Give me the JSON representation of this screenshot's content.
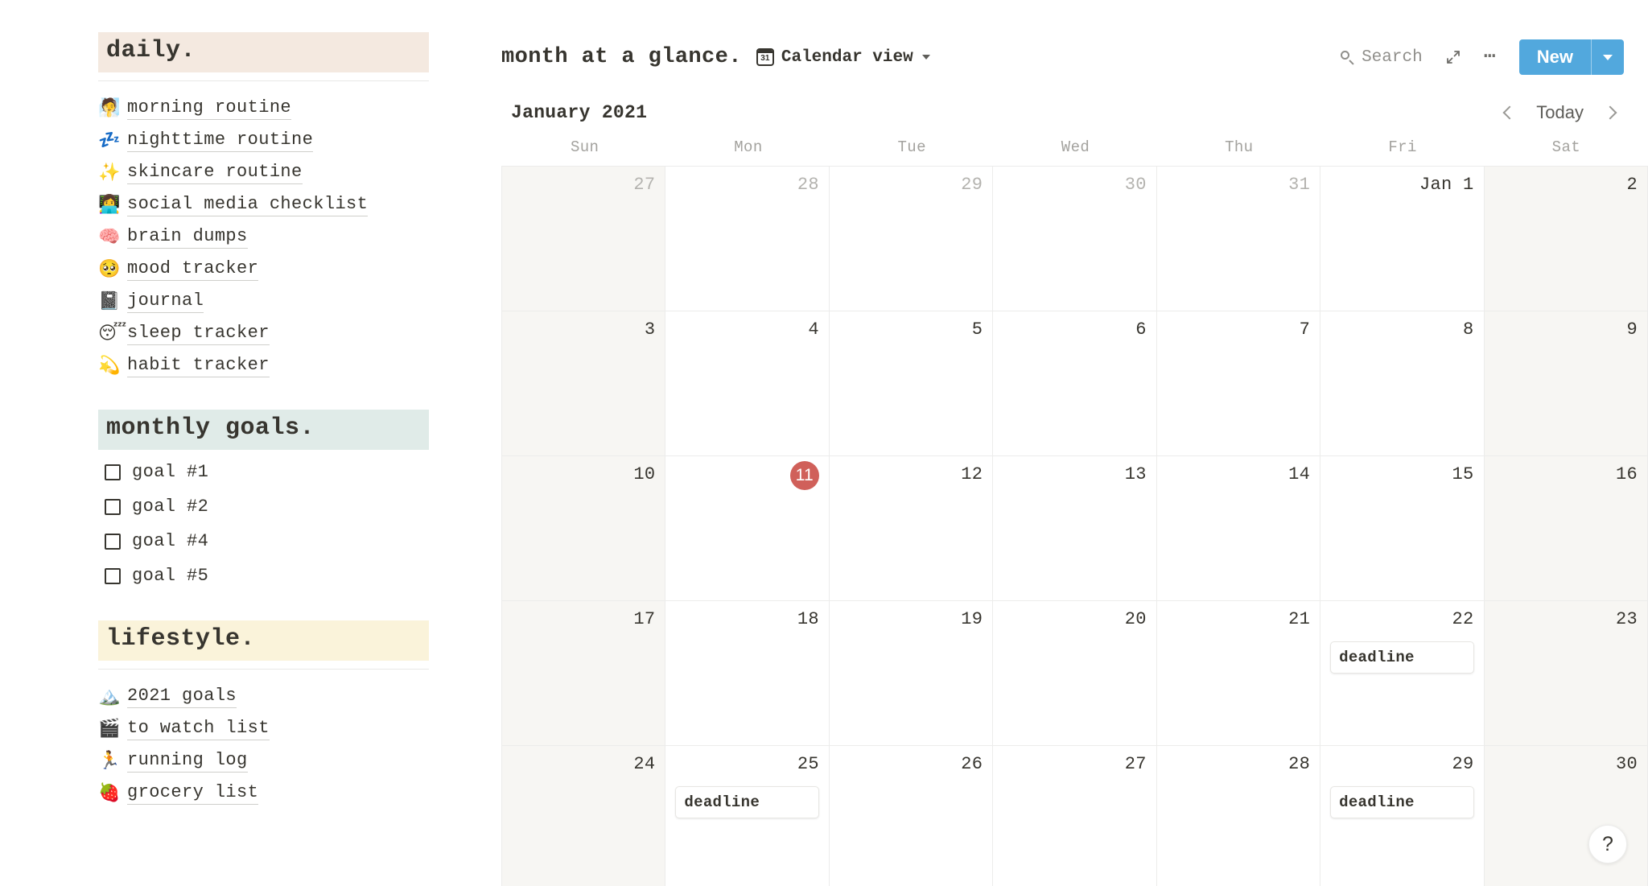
{
  "sidebar": {
    "sections": [
      {
        "title": "daily.",
        "highlight": "#f4e9e0",
        "kind": "links",
        "items": [
          {
            "emoji": "🧖",
            "icon_name": "person-steamy-room-emoji",
            "label": "morning routine"
          },
          {
            "emoji": "💤",
            "icon_name": "zzz-emoji",
            "label": "nighttime routine"
          },
          {
            "emoji": "✨",
            "icon_name": "sparkles-emoji",
            "label": "skincare routine"
          },
          {
            "emoji": "👩‍💻",
            "icon_name": "woman-technologist-emoji",
            "label": "social media checklist"
          },
          {
            "emoji": "🧠",
            "icon_name": "brain-emoji",
            "label": "brain dumps"
          },
          {
            "emoji": "🥺",
            "icon_name": "pleading-face-emoji",
            "label": "mood tracker"
          },
          {
            "emoji": "📓",
            "icon_name": "notebook-emoji",
            "label": "journal"
          },
          {
            "emoji": "😴",
            "icon_name": "sleeping-face-emoji",
            "label": "sleep tracker"
          },
          {
            "emoji": "💫",
            "icon_name": "dizzy-star-emoji",
            "label": "habit tracker"
          }
        ]
      },
      {
        "title": "monthly goals.",
        "highlight": "#e0ebe8",
        "kind": "todos",
        "items": [
          {
            "label": "goal #1",
            "checked": false
          },
          {
            "label": "goal #2",
            "checked": false
          },
          {
            "label": "goal #4",
            "checked": false
          },
          {
            "label": "goal #5",
            "checked": false
          }
        ]
      },
      {
        "title": "lifestyle.",
        "highlight": "#faf3da",
        "kind": "links",
        "items": [
          {
            "emoji": "🏔️",
            "icon_name": "mountain-emoji",
            "label": "2021 goals"
          },
          {
            "emoji": "🎬",
            "icon_name": "clapper-board-emoji",
            "label": "to watch list"
          },
          {
            "emoji": "🏃",
            "icon_name": "running-person-emoji",
            "label": "running log"
          },
          {
            "emoji": "🍓",
            "icon_name": "strawberry-emoji",
            "label": "grocery list"
          }
        ]
      }
    ]
  },
  "main": {
    "database_title": "month at a glance.",
    "view": {
      "label": "Calendar view",
      "icon": "calendar-31-icon",
      "icon_text": "31"
    },
    "toolbar": {
      "search_label": "Search",
      "expand_icon": "expand-diagonal-icon",
      "more_icon": "ellipsis-icon",
      "new_label": "New",
      "new_caret_icon": "chevron-down-icon",
      "new_color": "#52a8dd"
    },
    "month_label": "January 2021",
    "today_label": "Today",
    "prev_icon": "chevron-left-icon",
    "next_icon": "chevron-right-icon",
    "help_label": "?",
    "weekdays": [
      "Sun",
      "Mon",
      "Tue",
      "Wed",
      "Thu",
      "Fri",
      "Sat"
    ],
    "today_marker_color": "#d0605a",
    "weeks": [
      [
        {
          "day": "27",
          "muted": true,
          "weekend": true,
          "today": false,
          "events": []
        },
        {
          "day": "28",
          "muted": true,
          "weekend": false,
          "today": false,
          "events": []
        },
        {
          "day": "29",
          "muted": true,
          "weekend": false,
          "today": false,
          "events": []
        },
        {
          "day": "30",
          "muted": true,
          "weekend": false,
          "today": false,
          "events": []
        },
        {
          "day": "31",
          "muted": true,
          "weekend": false,
          "today": false,
          "events": []
        },
        {
          "day": "Jan 1",
          "muted": false,
          "weekend": false,
          "today": false,
          "events": []
        },
        {
          "day": "2",
          "muted": false,
          "weekend": true,
          "today": false,
          "events": []
        }
      ],
      [
        {
          "day": "3",
          "muted": false,
          "weekend": true,
          "today": false,
          "events": []
        },
        {
          "day": "4",
          "muted": false,
          "weekend": false,
          "today": false,
          "events": []
        },
        {
          "day": "5",
          "muted": false,
          "weekend": false,
          "today": false,
          "events": []
        },
        {
          "day": "6",
          "muted": false,
          "weekend": false,
          "today": false,
          "events": []
        },
        {
          "day": "7",
          "muted": false,
          "weekend": false,
          "today": false,
          "events": []
        },
        {
          "day": "8",
          "muted": false,
          "weekend": false,
          "today": false,
          "events": []
        },
        {
          "day": "9",
          "muted": false,
          "weekend": true,
          "today": false,
          "events": []
        }
      ],
      [
        {
          "day": "10",
          "muted": false,
          "weekend": true,
          "today": false,
          "events": []
        },
        {
          "day": "11",
          "muted": false,
          "weekend": false,
          "today": true,
          "events": []
        },
        {
          "day": "12",
          "muted": false,
          "weekend": false,
          "today": false,
          "events": []
        },
        {
          "day": "13",
          "muted": false,
          "weekend": false,
          "today": false,
          "events": []
        },
        {
          "day": "14",
          "muted": false,
          "weekend": false,
          "today": false,
          "events": []
        },
        {
          "day": "15",
          "muted": false,
          "weekend": false,
          "today": false,
          "events": []
        },
        {
          "day": "16",
          "muted": false,
          "weekend": true,
          "today": false,
          "events": []
        }
      ],
      [
        {
          "day": "17",
          "muted": false,
          "weekend": true,
          "today": false,
          "events": []
        },
        {
          "day": "18",
          "muted": false,
          "weekend": false,
          "today": false,
          "events": []
        },
        {
          "day": "19",
          "muted": false,
          "weekend": false,
          "today": false,
          "events": []
        },
        {
          "day": "20",
          "muted": false,
          "weekend": false,
          "today": false,
          "events": []
        },
        {
          "day": "21",
          "muted": false,
          "weekend": false,
          "today": false,
          "events": []
        },
        {
          "day": "22",
          "muted": false,
          "weekend": false,
          "today": false,
          "events": [
            "deadline"
          ]
        },
        {
          "day": "23",
          "muted": false,
          "weekend": true,
          "today": false,
          "events": []
        }
      ],
      [
        {
          "day": "24",
          "muted": false,
          "weekend": true,
          "today": false,
          "events": []
        },
        {
          "day": "25",
          "muted": false,
          "weekend": false,
          "today": false,
          "events": [
            "deadline"
          ]
        },
        {
          "day": "26",
          "muted": false,
          "weekend": false,
          "today": false,
          "events": []
        },
        {
          "day": "27",
          "muted": false,
          "weekend": false,
          "today": false,
          "events": []
        },
        {
          "day": "28",
          "muted": false,
          "weekend": false,
          "today": false,
          "events": []
        },
        {
          "day": "29",
          "muted": false,
          "weekend": false,
          "today": false,
          "events": [
            "deadline"
          ]
        },
        {
          "day": "30",
          "muted": false,
          "weekend": true,
          "today": false,
          "events": []
        }
      ]
    ]
  }
}
